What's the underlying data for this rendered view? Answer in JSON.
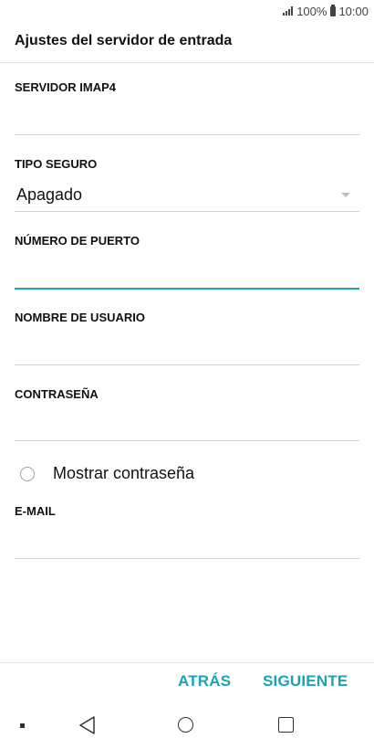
{
  "status_bar": {
    "battery": "100%",
    "time": "10:00"
  },
  "header": {
    "title": "Ajustes del servidor de entrada"
  },
  "form": {
    "imap_server": {
      "label": "SERVIDOR IMAP4",
      "value": ""
    },
    "security_type": {
      "label": "TIPO SEGURO",
      "value": "Apagado"
    },
    "port_number": {
      "label": "NÚMERO DE PUERTO",
      "value": ""
    },
    "username": {
      "label": "NOMBRE DE USUARIO",
      "value": ""
    },
    "password": {
      "label": "CONTRASEÑA",
      "value": ""
    },
    "show_password": {
      "label": "Mostrar contraseña",
      "checked": false
    },
    "email": {
      "label": "E-MAIL",
      "value": ""
    }
  },
  "actions": {
    "back": "ATRÁS",
    "next": "SIGUIENTE"
  },
  "colors": {
    "accent": "#1aa3b6",
    "divider": "#d4d4d4"
  },
  "icons": [
    "signal-icon",
    "battery-icon",
    "dropdown-arrow-icon",
    "radio-icon",
    "nav-back-icon",
    "nav-home-icon",
    "nav-recents-icon"
  ]
}
